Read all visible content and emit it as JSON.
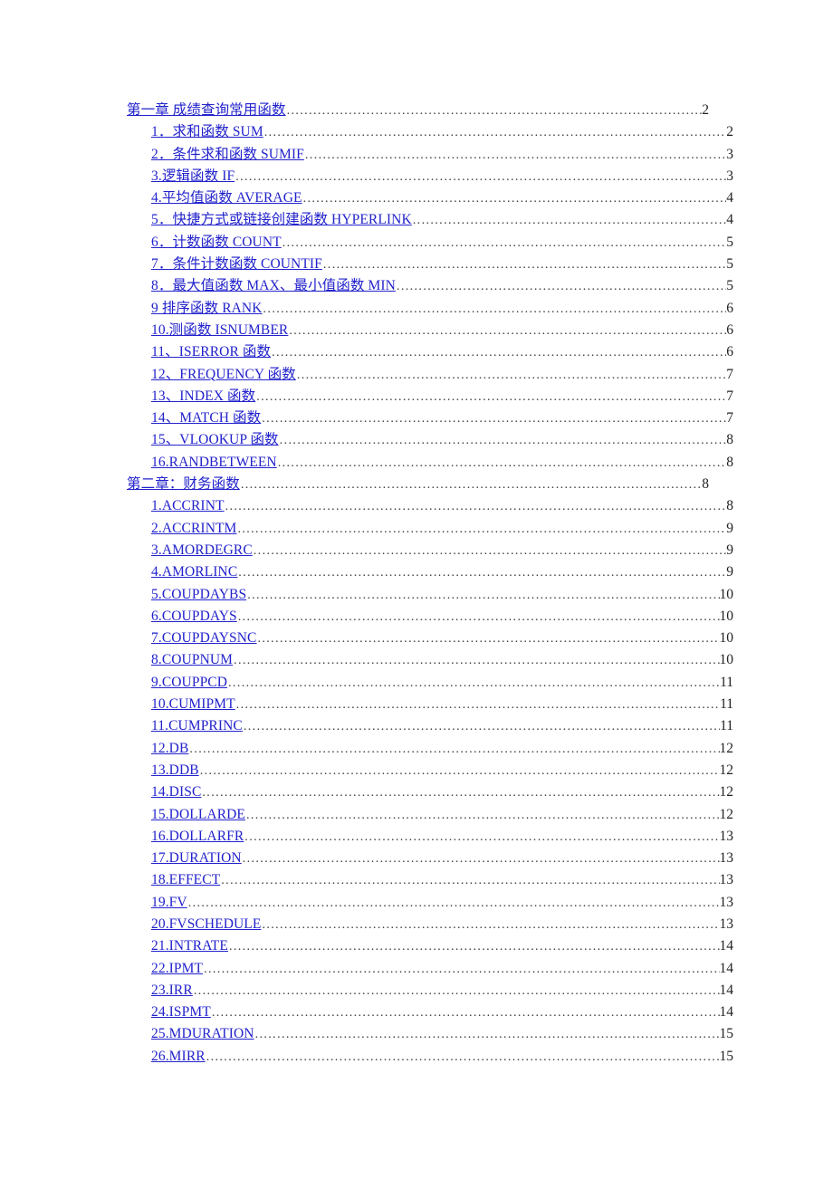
{
  "document": {
    "type": "table-of-contents",
    "link_color": "#2222CC",
    "page_number_color": "#222222",
    "background_color": "#FFFFFF"
  },
  "toc": {
    "entries": [
      {
        "level": 1,
        "title": "第一章  成绩查询常用函数",
        "page": "2"
      },
      {
        "level": 2,
        "title": "1．求和函数 SUM",
        "page": "2"
      },
      {
        "level": 2,
        "title": "2．条件求和函数 SUMIF ",
        "page": "3"
      },
      {
        "level": 2,
        "title": "3.逻辑函数 IF",
        "page": "3"
      },
      {
        "level": 2,
        "title": "4.平均值函数 AVERAGE ",
        "page": "4"
      },
      {
        "level": 2,
        "title": "5．快捷方式或链接创建函数 HYPERLINK",
        "page": "4"
      },
      {
        "level": 2,
        "title": "6．计数函数 COUNT",
        "page": "5"
      },
      {
        "level": 2,
        "title": "7．条件计数函数 COUNTIF ",
        "page": "5"
      },
      {
        "level": 2,
        "title": "8．最大值函数 MAX、最小值函数 MIN ",
        "page": "5"
      },
      {
        "level": 2,
        "title": "9 排序函数 RANK",
        "page": "6"
      },
      {
        "level": 2,
        "title": "10.测函数 ISNUMBER",
        "page": "6"
      },
      {
        "level": 2,
        "title": "11、ISERROR 函数",
        "page": "6"
      },
      {
        "level": 2,
        "title": "12、FREQUENCY 函数",
        "page": "7"
      },
      {
        "level": 2,
        "title": "13、INDEX 函数",
        "page": "7"
      },
      {
        "level": 2,
        "title": "14、MATCH 函数",
        "page": "7"
      },
      {
        "level": 2,
        "title": "15、VLOOKUP 函数 ",
        "page": "8"
      },
      {
        "level": 2,
        "title": "16.RANDBETWEEN",
        "page": "8"
      },
      {
        "level": 1,
        "title": "第二章：财务函数",
        "page": "8"
      },
      {
        "level": 2,
        "title": "1.ACCRINT ",
        "page": "8"
      },
      {
        "level": 2,
        "title": "2.ACCRINTM ",
        "page": "9"
      },
      {
        "level": 2,
        "title": "3.AMORDEGRC",
        "page": "9"
      },
      {
        "level": 2,
        "title": "4.AMORLINC ",
        "page": "9"
      },
      {
        "level": 2,
        "title": "5.COUPDAYBS ",
        "page": "10"
      },
      {
        "level": 2,
        "title": "6.COUPDAYS",
        "page": "10"
      },
      {
        "level": 2,
        "title": "7.COUPDAYSNC ",
        "page": "10"
      },
      {
        "level": 2,
        "title": "8.COUPNUM",
        "page": "10"
      },
      {
        "level": 2,
        "title": "9.COUPPCD ",
        "page": "11"
      },
      {
        "level": 2,
        "title": "10.CUMIPMT ",
        "page": "11"
      },
      {
        "level": 2,
        "title": "11.CUMPRINC",
        "page": "11"
      },
      {
        "level": 2,
        "title": "12.DB ",
        "page": "12"
      },
      {
        "level": 2,
        "title": "13.DDB ",
        "page": "12"
      },
      {
        "level": 2,
        "title": "14.DISC ",
        "page": "12"
      },
      {
        "level": 2,
        "title": "15.DOLLARDE",
        "page": "12"
      },
      {
        "level": 2,
        "title": "16.DOLLARFR ",
        "page": "13"
      },
      {
        "level": 2,
        "title": "17.DURATION",
        "page": "13"
      },
      {
        "level": 2,
        "title": "18.EFFECT ",
        "page": "13"
      },
      {
        "level": 2,
        "title": "19.FV ",
        "page": "13"
      },
      {
        "level": 2,
        "title": "20.FVSCHEDULE",
        "page": "13"
      },
      {
        "level": 2,
        "title": "21.INTRATE ",
        "page": "14"
      },
      {
        "level": 2,
        "title": "22.IPMT ",
        "page": "14"
      },
      {
        "level": 2,
        "title": "23.IRR",
        "page": "14"
      },
      {
        "level": 2,
        "title": "24.ISPMT",
        "page": "14"
      },
      {
        "level": 2,
        "title": "25.MDURATION ",
        "page": "15"
      },
      {
        "level": 2,
        "title": "26.MIRR ",
        "page": "15"
      }
    ]
  }
}
